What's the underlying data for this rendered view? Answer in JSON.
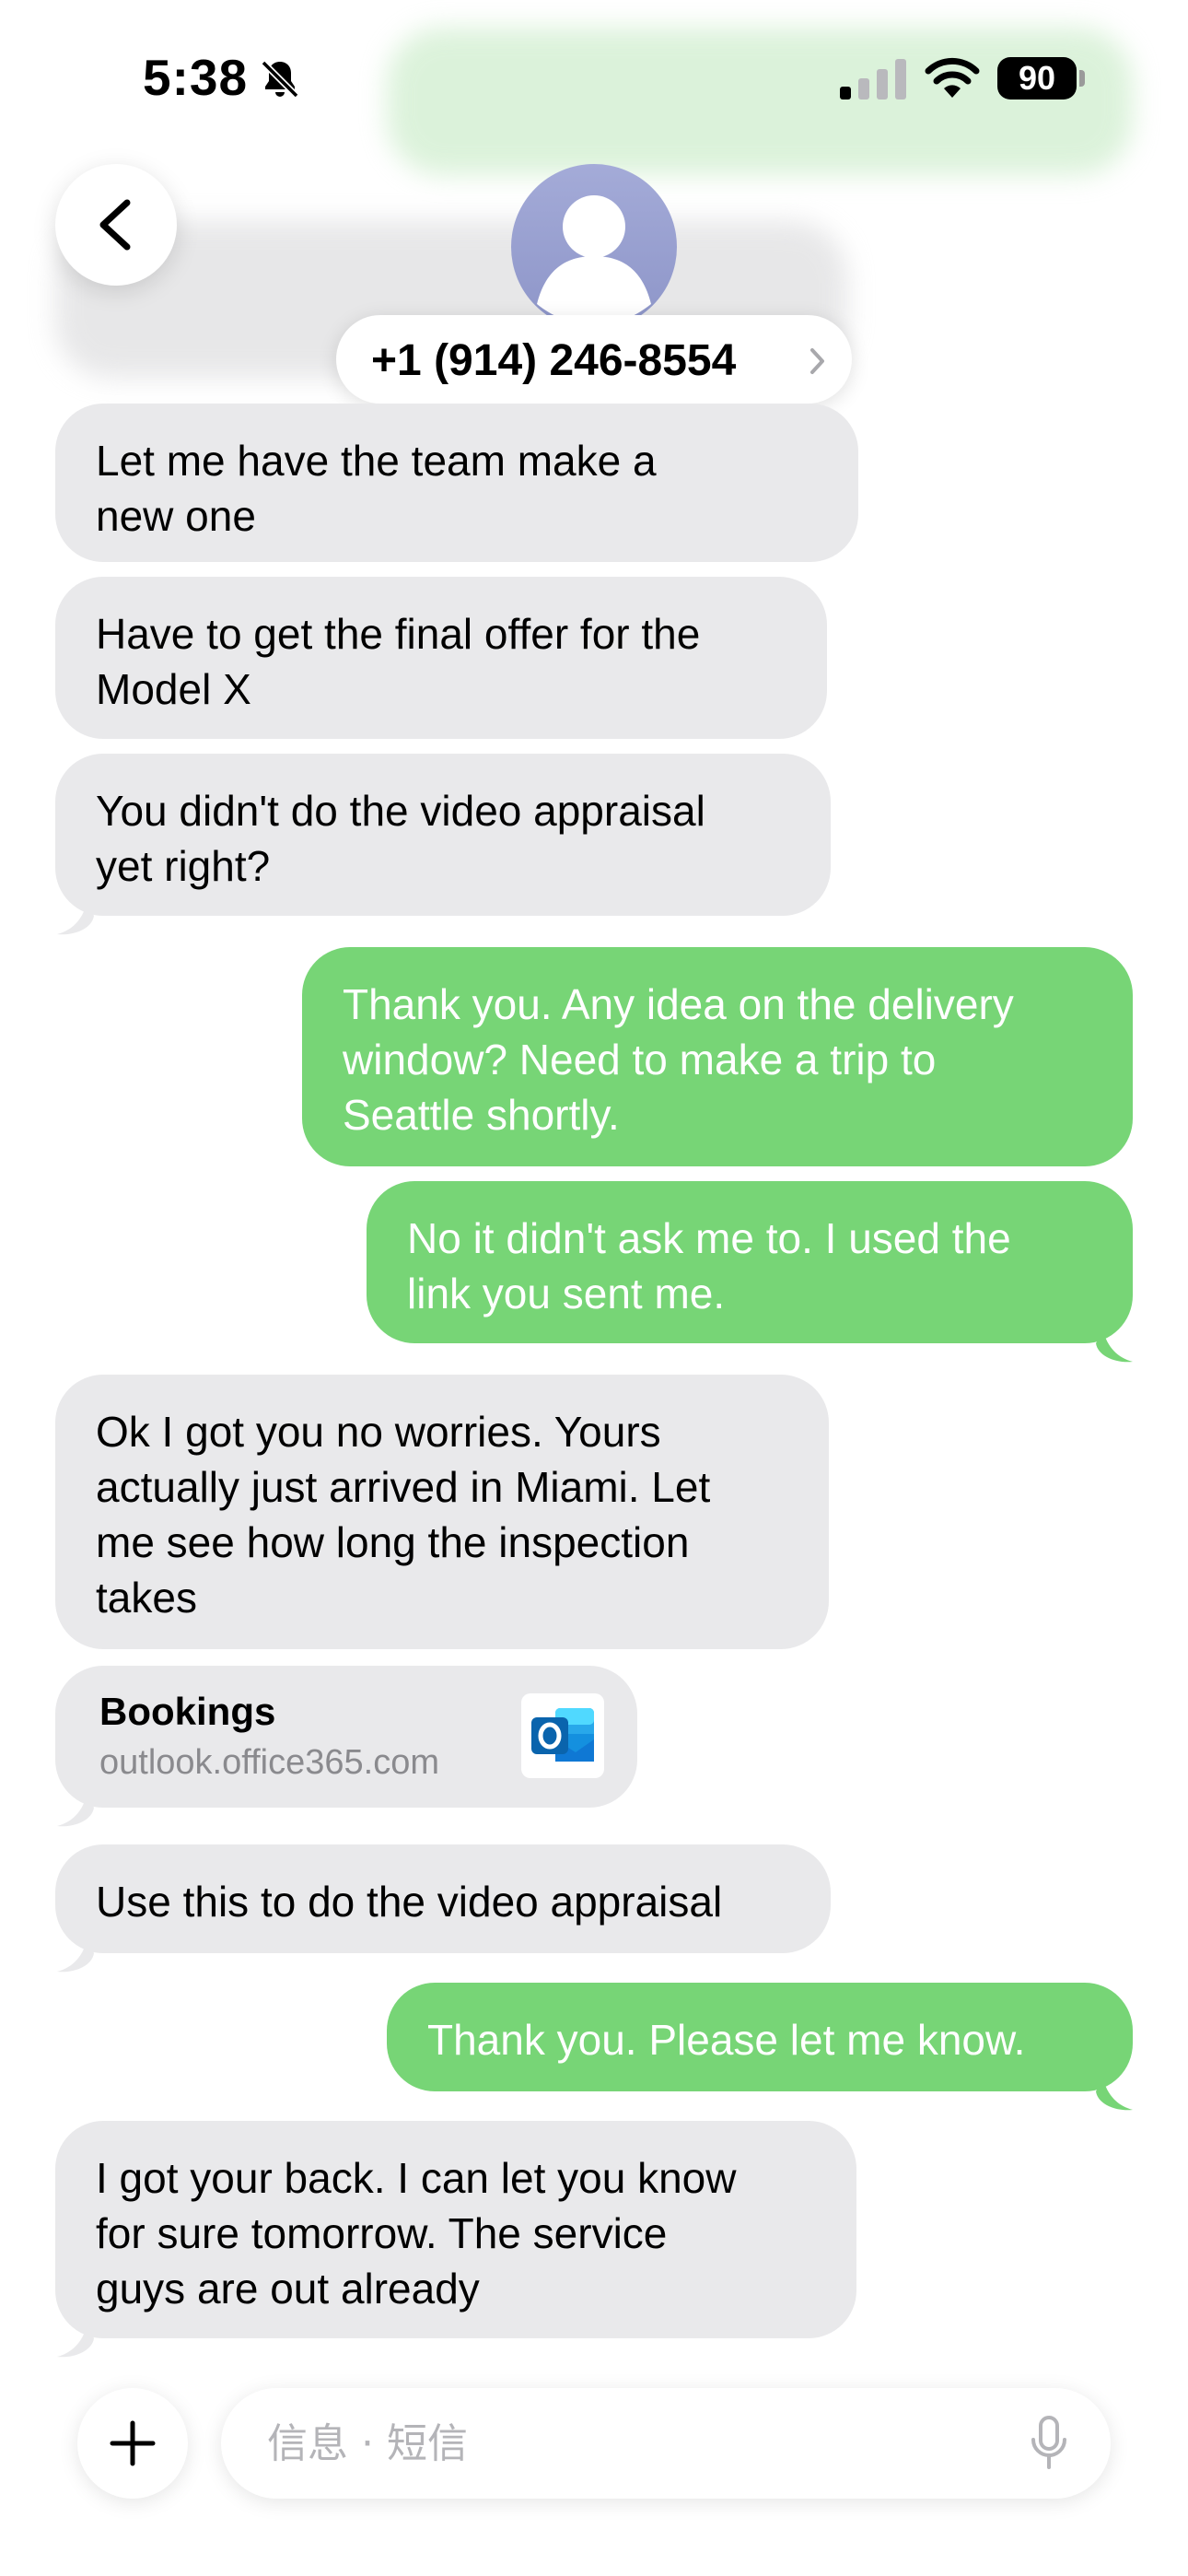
{
  "status_bar": {
    "time": "5:38",
    "battery": "90",
    "icons": [
      "bell-slash-icon",
      "cellular-signal-icon",
      "wifi-icon",
      "battery-icon"
    ]
  },
  "header": {
    "contact": "+1 (914) 246-8554",
    "icons": [
      "back-chevron-icon",
      "person-icon",
      "chevron-right-icon"
    ]
  },
  "messages": [
    {
      "direction": "in",
      "text": "Let me have the team make a\nnew one"
    },
    {
      "direction": "in",
      "text": "Have to get the final offer for the\nModel X"
    },
    {
      "direction": "in",
      "text": "You didn't do the video appraisal\nyet right?"
    },
    {
      "direction": "out",
      "text": "Thank you. Any idea on the delivery\nwindow? Need to make a trip to\nSeattle shortly."
    },
    {
      "direction": "out",
      "text": "No it didn't ask me to. I used the\nlink you sent me."
    },
    {
      "direction": "in",
      "text": "Ok I got you no worries. Yours\nactually just arrived in Miami. Let\nme see how long the inspection\ntakes"
    },
    {
      "direction": "in",
      "type": "link",
      "title": "Bookings",
      "domain": "outlook.office365.com",
      "icon": "outlook-icon"
    },
    {
      "direction": "in",
      "text": "Use this to do the video appraisal"
    },
    {
      "direction": "out",
      "text": "Thank you. Please let me know."
    },
    {
      "direction": "in",
      "text": "I got your back. I can let you know\nfor sure tomorrow. The service\nguys are out already"
    }
  ],
  "composer": {
    "placeholder": "信息 · 短信",
    "icons": [
      "plus-icon",
      "microphone-icon"
    ]
  },
  "colors": {
    "incoming_bubble": "#e9e9eb",
    "outgoing_bubble": "#77d576",
    "avatar": "#9aa1d2"
  }
}
